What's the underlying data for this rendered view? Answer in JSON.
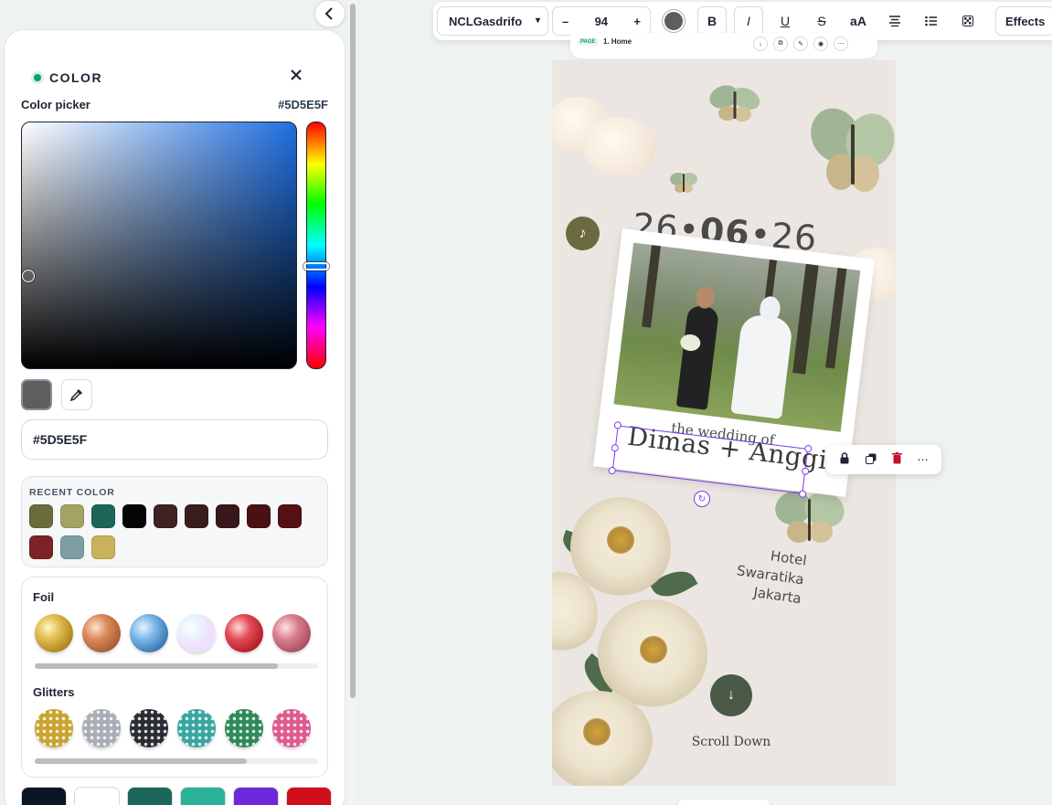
{
  "panel": {
    "title": "COLOR",
    "picker_label": "Color picker",
    "picker_hex": "#5D5E5F",
    "hex_input_value": "#5D5E5F",
    "current_color": "#5D5E5F",
    "recent_title": "RECENT COLOR",
    "recent_colors": [
      "#6a6c3c",
      "#a3a363",
      "#1b6659",
      "#050505",
      "#3e2224",
      "#3a1d1f",
      "#3a171a",
      "#4a1013",
      "#551014",
      "#7b2325",
      "#7e9ea6",
      "#c8b25c"
    ],
    "foil_title": "Foil",
    "foil_orbs": [
      "gold-foil",
      "copper-foil",
      "blue-foil",
      "holographic-foil",
      "red-foil",
      "rose-foil"
    ],
    "glitter_title": "Glitters",
    "glitter_orbs": [
      "gold-glitter",
      "silver-glitter",
      "black-glitter",
      "teal-glitter",
      "green-glitter",
      "pink-glitter"
    ],
    "bottom_swatches": [
      "#0b1624",
      "#ffffff",
      "#1b6659",
      "#2bb29a",
      "#6d28d9",
      "#d00f1a"
    ]
  },
  "toolbar": {
    "font_name": "NCLGasdrifo",
    "font_size": "94",
    "minus": "–",
    "plus": "+",
    "text_color": "#5D5E5F",
    "case_label": "aA",
    "effects_label": "Effects"
  },
  "pagebar": {
    "page_tag": "PAGE",
    "page_name": "1. Home"
  },
  "invitation": {
    "date_day": "26",
    "date_month": "06",
    "date_year": "26",
    "wedding_of": "the wedding of",
    "names": "Dimas + Anggi",
    "venue_line1": "Hotel Swaratika",
    "venue_line2": "Jakarta",
    "scroll_label": "Scroll Down"
  }
}
